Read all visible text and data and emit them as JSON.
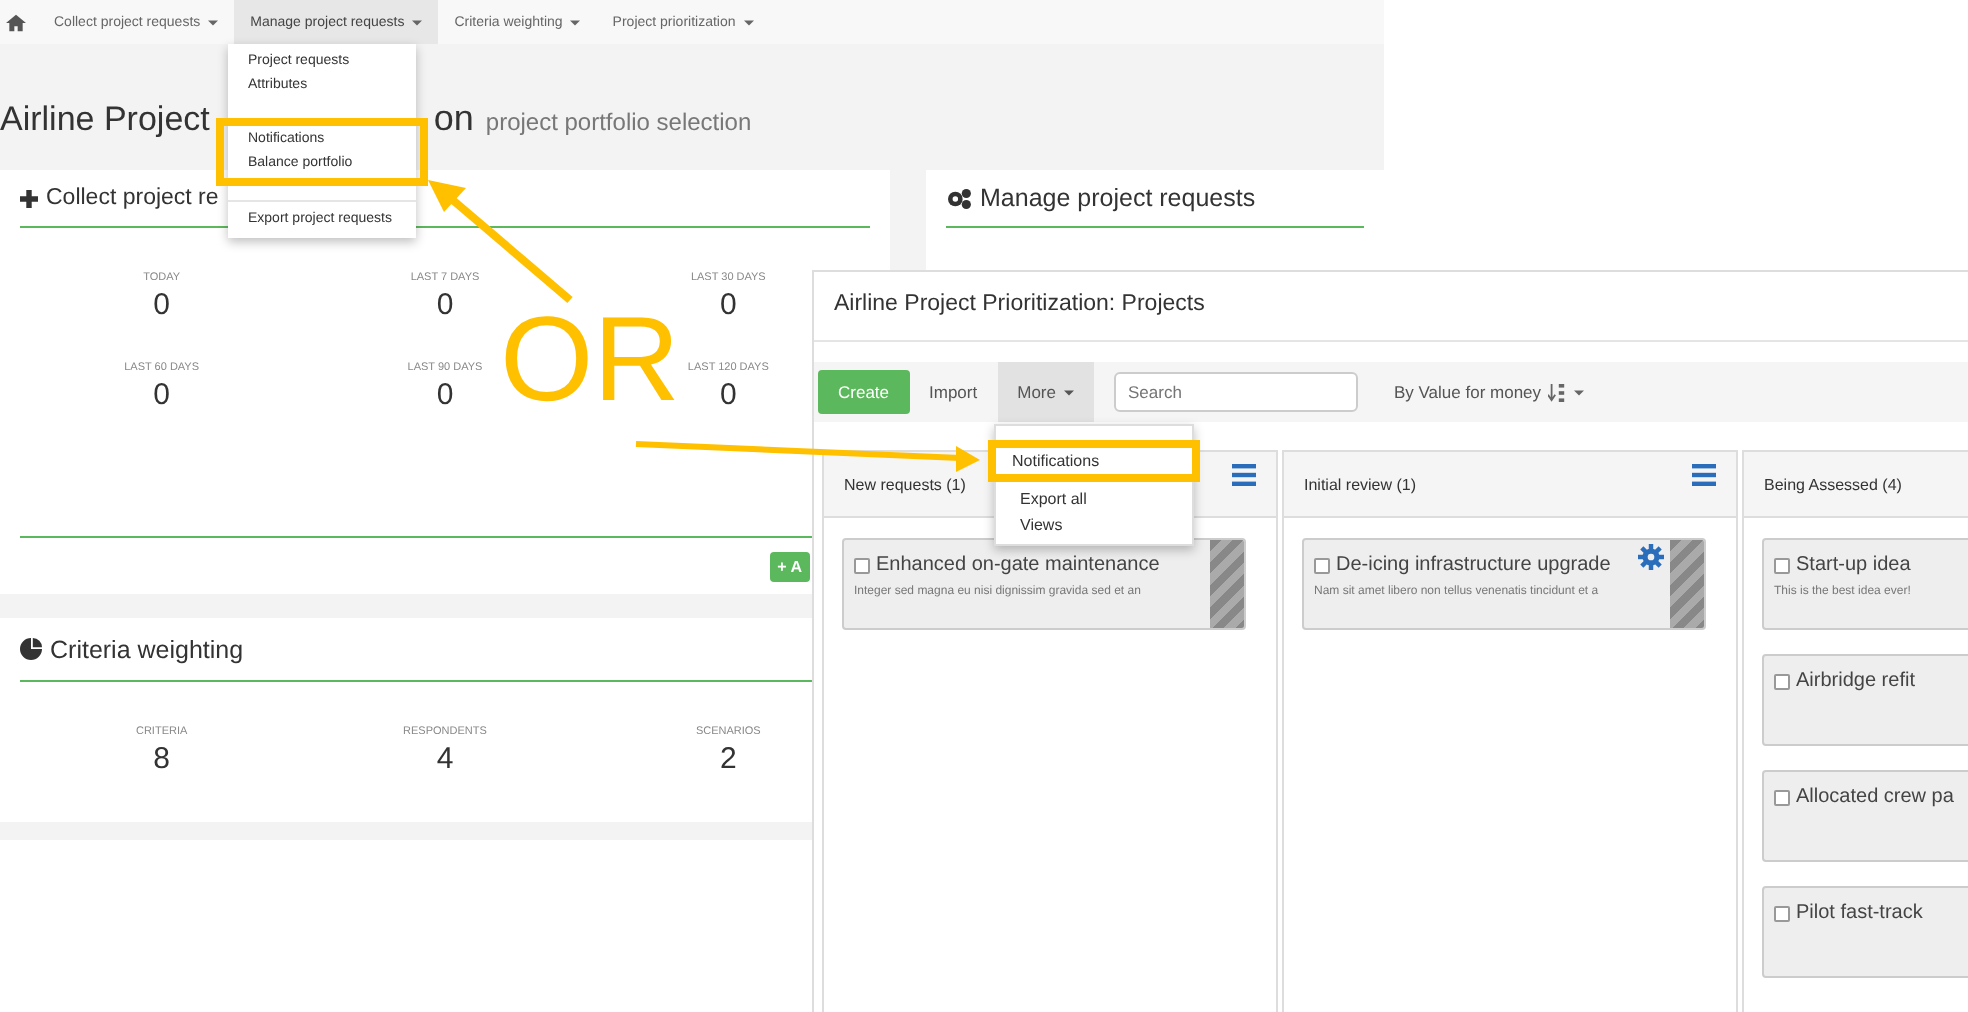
{
  "back_screen": {
    "nav": [
      {
        "label": "Collect project requests",
        "selected": false
      },
      {
        "label": "Manage project requests",
        "selected": true
      },
      {
        "label": "Criteria weighting",
        "selected": false
      },
      {
        "label": "Project prioritization",
        "selected": false
      }
    ],
    "menu": [
      {
        "label": "Project requests",
        "highlighted": false
      },
      {
        "label": "Attributes",
        "highlighted": false
      },
      {
        "label": "Notifications",
        "highlighted": true
      },
      {
        "label": "Balance portfolio",
        "highlighted": true
      },
      {
        "label": "Export project requests",
        "highlighted": false
      }
    ],
    "title_start": "Airline Project",
    "title_end": "on",
    "subtitle": "project portfolio selection",
    "collect_card": {
      "title": "Collect project re",
      "stats": [
        {
          "label": "TODAY",
          "value": "0"
        },
        {
          "label": "LAST 7 DAYS",
          "value": "0"
        },
        {
          "label": "LAST 30 DAYS",
          "value": "0"
        },
        {
          "label": "LAST 60 DAYS",
          "value": "0"
        },
        {
          "label": "LAST 90 DAYS",
          "value": "0"
        },
        {
          "label": "LAST 120 DAYS",
          "value": "0"
        }
      ],
      "button": "+ A"
    },
    "manage_card": {
      "title": "Manage project requests"
    },
    "criteria_card": {
      "title": "Criteria weighting",
      "stats": [
        {
          "label": "CRITERIA",
          "value": "8"
        },
        {
          "label": "RESPONDENTS",
          "value": "4"
        },
        {
          "label": "SCENARIOS",
          "value": "2"
        }
      ]
    }
  },
  "front_screen": {
    "title": "Airline Project Prioritization: Projects",
    "toolbar": [
      {
        "label": "Create",
        "kind": "primary",
        "selected": false
      },
      {
        "label": "Import",
        "kind": "plain",
        "selected": false
      },
      {
        "label": "More",
        "kind": "dropdown",
        "selected": true
      }
    ],
    "search": {
      "placeholder": "Search"
    },
    "sort": "By Value for money",
    "menu": [
      {
        "label": "Notifications",
        "highlighted": true
      },
      {
        "label": "Export all",
        "highlighted": false
      },
      {
        "label": "Views",
        "highlighted": false
      }
    ],
    "columns": [
      {
        "title": "New requests (1)",
        "menu": true,
        "cards": [
          {
            "title": "Enhanced on-gate maintenance",
            "text": "Integer sed magna eu nisi dignissim gravida sed et an",
            "checked": false,
            "striped": true,
            "gear": false
          }
        ]
      },
      {
        "title": "Initial review (1)",
        "menu": true,
        "cards": [
          {
            "title": "De-icing infrastructure upgrade",
            "text": "Nam sit amet libero non tellus venenatis tincidunt et a",
            "checked": false,
            "striped": true,
            "gear": true
          }
        ]
      },
      {
        "title": "Being Assessed (4)",
        "cards": [
          {
            "title": "Start-up idea",
            "text": "This is the best idea ever!",
            "checked": false
          },
          {
            "title": "Airbridge refit",
            "checked": false
          },
          {
            "title": "Allocated crew pa",
            "checked": false
          },
          {
            "title": "Pilot fast-track",
            "checked": false
          }
        ]
      }
    ]
  },
  "annotation": {
    "text": "OR"
  }
}
